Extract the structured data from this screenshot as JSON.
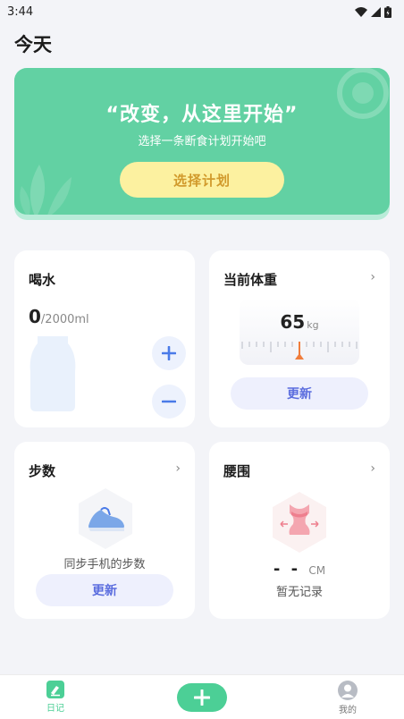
{
  "status_bar": {
    "time": "3:44"
  },
  "page": {
    "title": "今天"
  },
  "banner": {
    "quote": "“改变，从这里开始”",
    "subtitle": "选择一条断食计划开始吧",
    "button_label": "选择计划"
  },
  "water": {
    "title": "喝水",
    "current": "0",
    "goal": "/2000ml",
    "add_icon": "plus-icon",
    "remove_icon": "minus-icon"
  },
  "weight": {
    "title": "当前体重",
    "value": "65",
    "unit": "kg",
    "update_label": "更新"
  },
  "steps": {
    "title": "步数",
    "description": "同步手机的步数",
    "update_label": "更新",
    "icon": "sneaker-icon"
  },
  "waist": {
    "title": "腰围",
    "value": "- -",
    "unit": "CM",
    "note": "暂无记录",
    "icon": "waist-figure-icon"
  },
  "tabbar": {
    "items": [
      {
        "label": "日记",
        "icon": "diary-icon",
        "active": true
      },
      {
        "label": "我的",
        "icon": "profile-icon",
        "active": false
      }
    ],
    "center_icon": "plus-icon"
  },
  "colors": {
    "accent_green": "#62d1a3",
    "button_yellow": "#fcf1a0",
    "button_text_gold": "#d19a2c",
    "blue_accent": "#5b6dde",
    "scale_pointer": "#f07d3c"
  }
}
